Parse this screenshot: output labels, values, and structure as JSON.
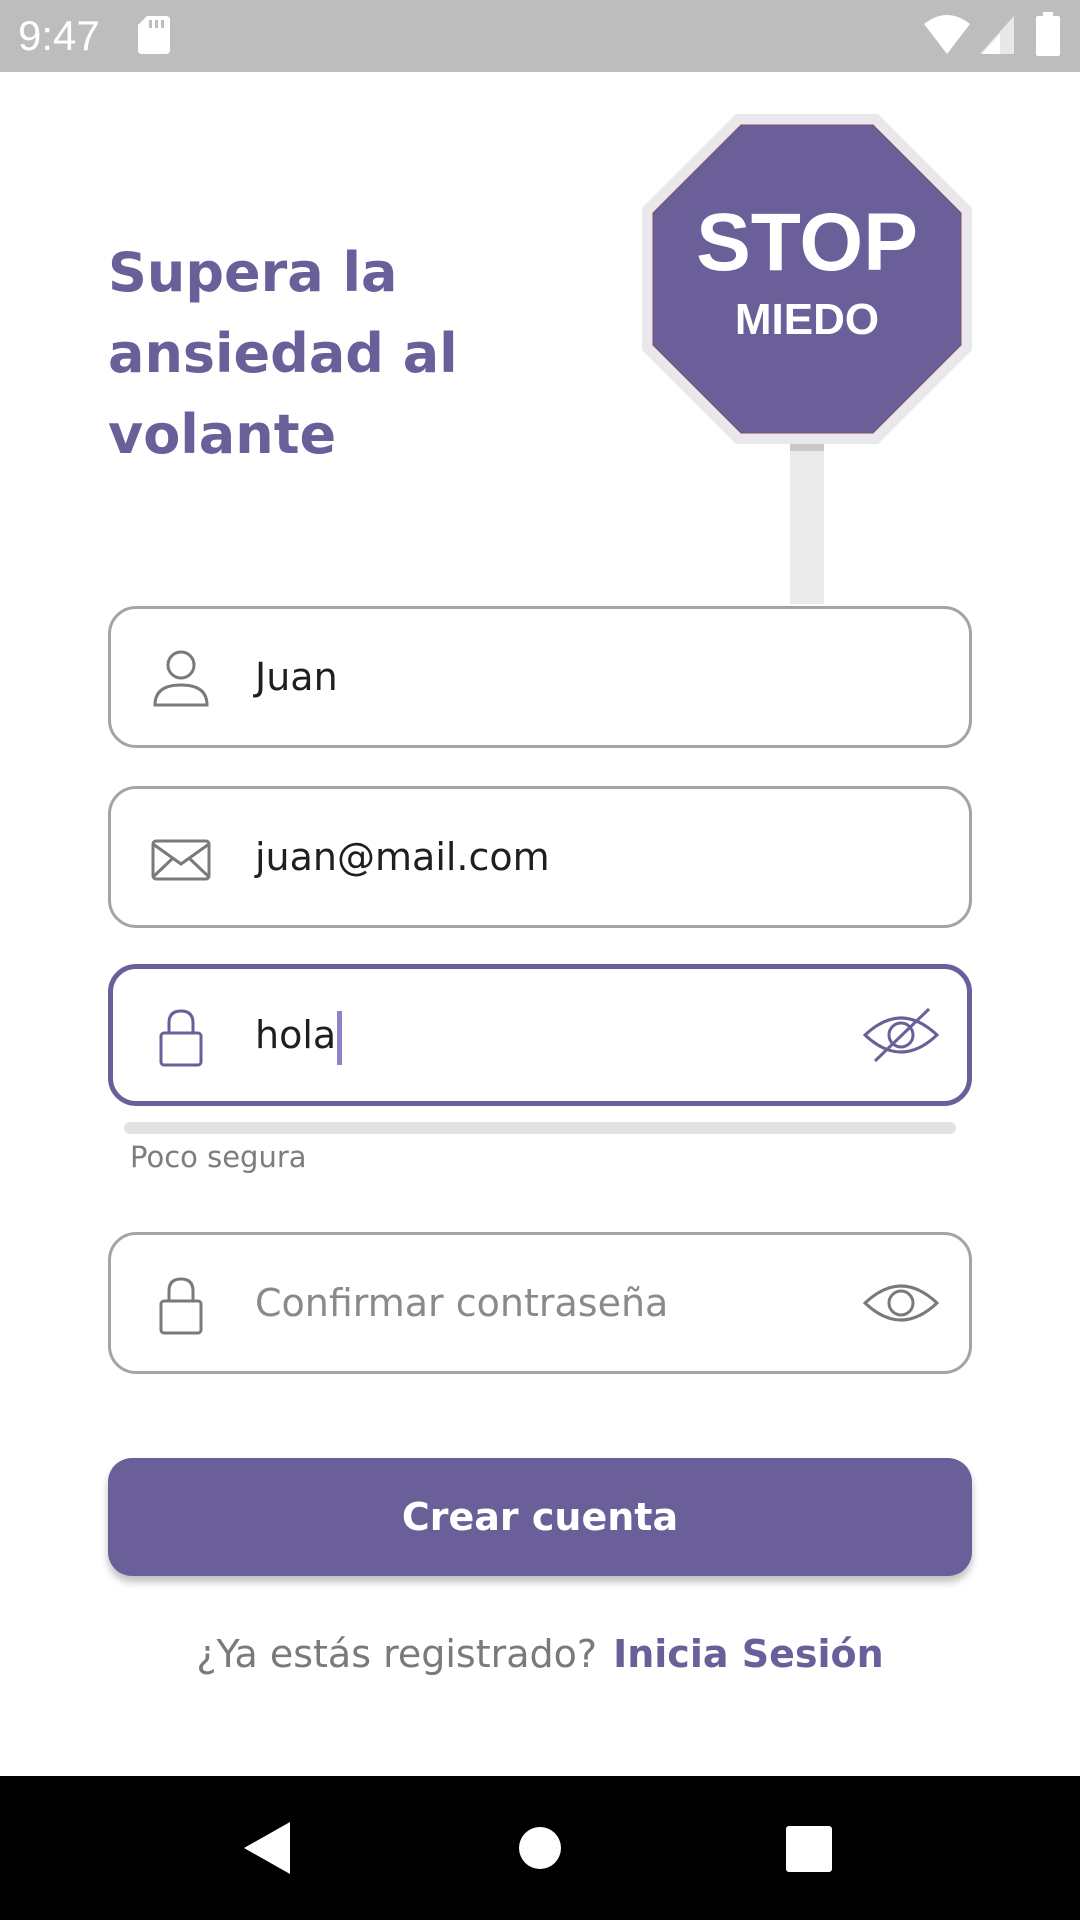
{
  "status_bar": {
    "time": "9:47",
    "icons": [
      "sd-card-icon",
      "wifi-icon",
      "signal-icon",
      "battery-icon"
    ]
  },
  "hero": {
    "headline": "Supera la\nansiedad al\nvolante",
    "sign_text_main": "STOP",
    "sign_text_sub": "MIEDO"
  },
  "form": {
    "name": {
      "value": "Juan",
      "icon": "user-icon"
    },
    "email": {
      "value": "juan@mail.com",
      "icon": "envelope-icon"
    },
    "password": {
      "value": "hola",
      "icon": "lock-icon",
      "toggle_icon": "eye-slash-icon",
      "focused": true
    },
    "password_strength": {
      "label": "Poco segura",
      "level": 0
    },
    "confirm_password": {
      "value": "",
      "placeholder": "Confirmar contraseña",
      "icon": "lock-icon",
      "toggle_icon": "eye-icon"
    }
  },
  "actions": {
    "create_account_label": "Crear cuenta",
    "login_prompt": "¿Ya estás registrado?",
    "login_link": "Inicia Sesión"
  },
  "nav_bar": {
    "icons": [
      "back-icon",
      "home-icon",
      "recents-icon"
    ]
  },
  "colors": {
    "accent": "#6b5f9a",
    "status_bar": "#bdbdbd",
    "field_border": "#a4a4a4",
    "strength_track": "#e2e2e2",
    "caret": "#8f82c8",
    "nav_bar": "#000000"
  }
}
